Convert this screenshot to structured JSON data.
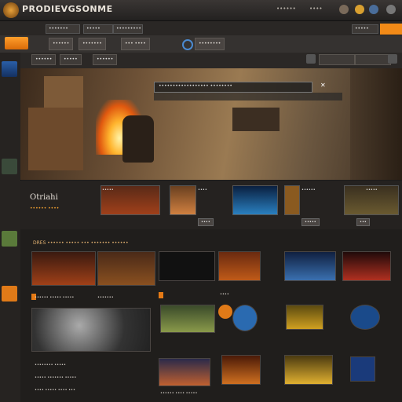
{
  "app": {
    "title": "PRODIEVGSONME"
  },
  "colors": {
    "accent": "#f28a17",
    "background": "#1d1b1a",
    "panel": "#252220"
  },
  "titlebar": {
    "right_links": [
      "•••••• ",
      "••••",
      "•••"
    ]
  },
  "navbar": {
    "pills": [
      "•••••••",
      "•••••",
      "•••••••••"
    ],
    "right_label": "•••••"
  },
  "toolbar": {
    "buttons": [
      "••••••",
      "•••••••",
      "••• ••••",
      "••••••••"
    ]
  },
  "filterbar": {
    "buttons": [
      "••••••",
      "•••••",
      "••••••"
    ]
  },
  "hero": {
    "bar_label": "•••••••••••••••••• ••••••••",
    "bar_icon": "✕"
  },
  "featured": {
    "title": "Otriahi",
    "subtitle": "•••••• ••••",
    "tile_captions": [
      "•••••",
      "••••",
      "••••••",
      "•••••"
    ],
    "tile_buttons": [
      "••••",
      "•••••",
      "•••"
    ]
  },
  "grid": {
    "header": "DRES  •••••• ••••• ••• ••••••• ••••••",
    "row_captions": [
      "•••••• ••••• •••••",
      "•••••••",
      "••••",
      "•••••• •••• •••••"
    ],
    "left_labels": [
      "•••••••• •••••",
      "••••• ••••••• •••••",
      "•••• ••••• •••• •••"
    ]
  },
  "icons": {
    "logo": "app-logo-icon",
    "home": "home-icon",
    "rail": [
      "navigation-icon",
      "star-icon",
      "gear-icon",
      "flame-icon"
    ]
  }
}
